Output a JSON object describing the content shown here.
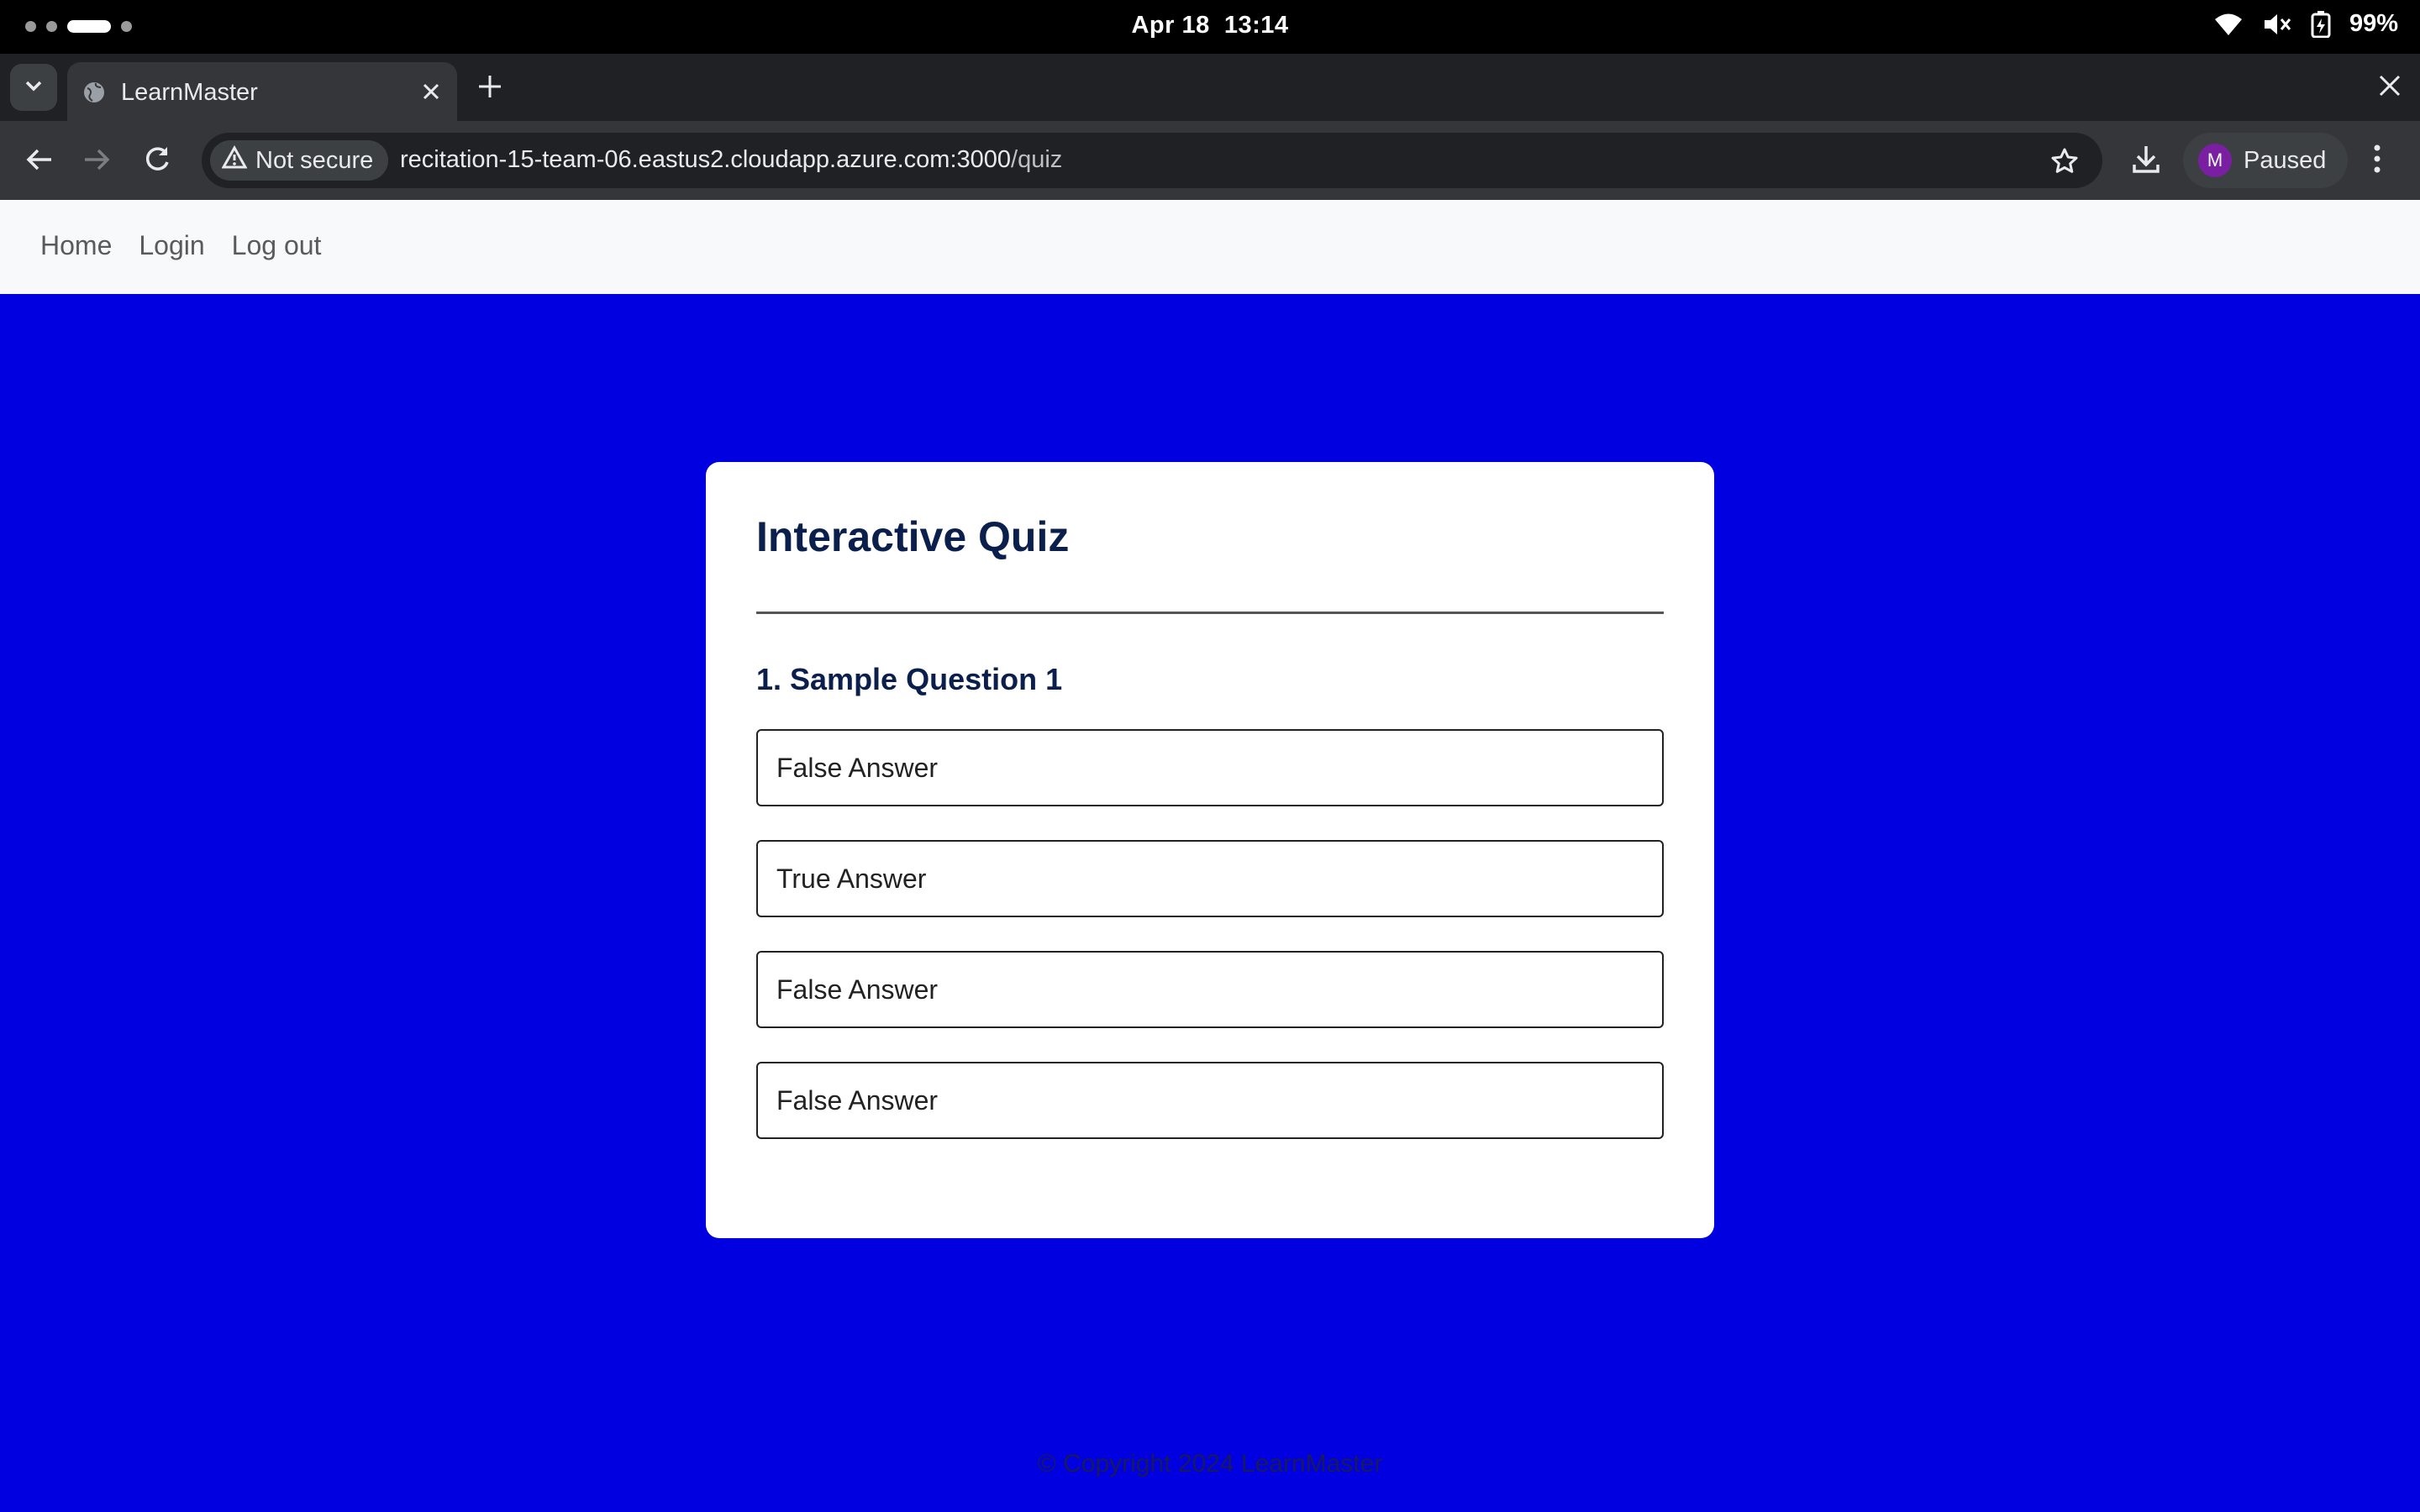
{
  "system": {
    "date": "Apr 18",
    "time": "13:14",
    "battery": "99%",
    "icons": [
      "wifi-icon",
      "volume-muted-icon",
      "battery-charging-icon"
    ]
  },
  "browser": {
    "tab": {
      "title": "LearnMaster"
    },
    "security_label": "Not secure",
    "url": "recitation-15-team-06.eastus2.cloudapp.azure.com:3000/quiz",
    "profile": {
      "initial": "M",
      "status": "Paused",
      "color": "#7b1fa2"
    }
  },
  "nav": {
    "links": [
      "Home",
      "Login",
      "Log out"
    ]
  },
  "quiz": {
    "title": "Interactive Quiz",
    "question": "1. Sample Question 1",
    "answers": [
      "False Answer",
      "True Answer",
      "False Answer",
      "False Answer"
    ]
  },
  "footer": {
    "text": "© Copyright 2024 LearnMaster"
  },
  "colors": {
    "page_background": "#0000e0",
    "heading": "#0b1f4d",
    "navbar_background": "#f8f9fa"
  }
}
